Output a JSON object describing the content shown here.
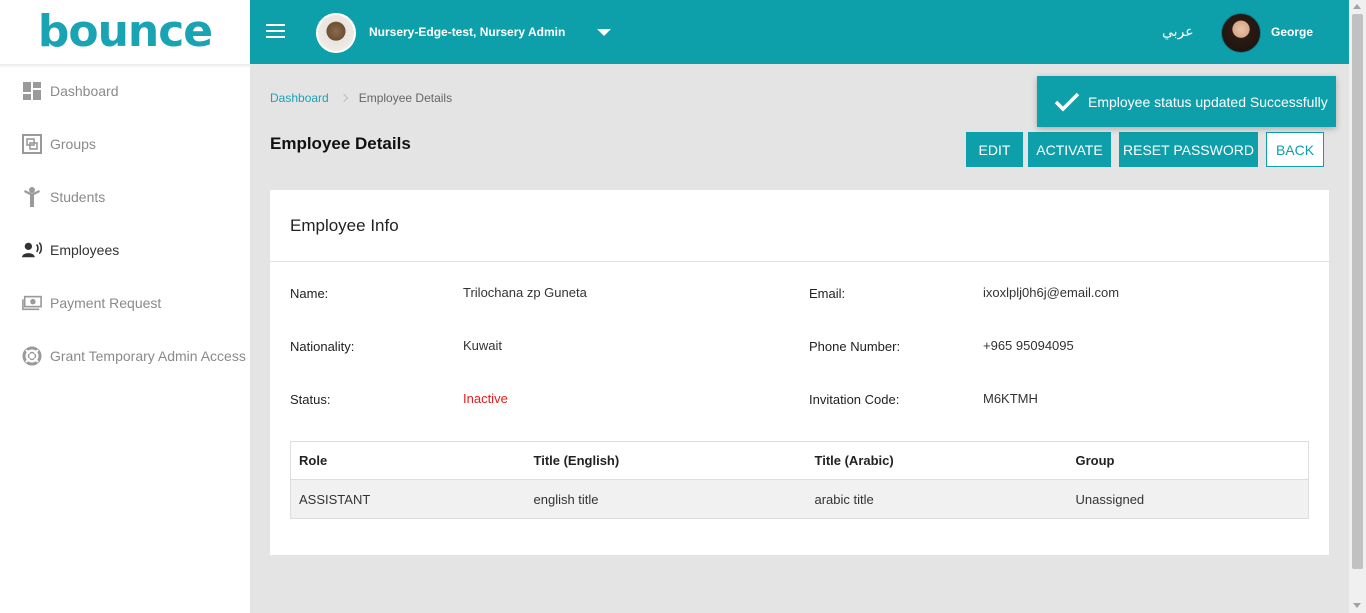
{
  "brand": {
    "logo_text": "bounce",
    "accent": "#0ea0aa",
    "accent_green": "#8cc63f"
  },
  "sidebar": {
    "items": [
      {
        "label": "Dashboard",
        "icon": "dashboard-icon"
      },
      {
        "label": "Groups",
        "icon": "groups-icon"
      },
      {
        "label": "Students",
        "icon": "student-icon"
      },
      {
        "label": "Employees",
        "icon": "employees-icon",
        "active": true
      },
      {
        "label": "Payment Request",
        "icon": "payment-icon"
      },
      {
        "label": "Grant Temporary Admin Access",
        "icon": "lifebuoy-icon"
      }
    ]
  },
  "topbar": {
    "nursery_name": "Nursery-Edge-test, Nursery Admin",
    "language_switch": "عربي",
    "user_name": "George"
  },
  "breadcrumb": {
    "home": "Dashboard",
    "current": "Employee Details"
  },
  "page": {
    "title": "Employee Details"
  },
  "actions": {
    "edit": "EDIT",
    "activate": "ACTIVATE",
    "reset_password": "RESET PASSWORD",
    "back": "BACK"
  },
  "toast": {
    "message": "Employee status updated Successfully"
  },
  "card": {
    "title": "Employee Info",
    "fields": {
      "name_label": "Name:",
      "name_value": "Trilochana zp Guneta",
      "email_label": "Email:",
      "email_value": "ixoxlplj0h6j@email.com",
      "nationality_label": "Nationality:",
      "nationality_value": "Kuwait",
      "phone_label": "Phone Number:",
      "phone_value": "+965 95094095",
      "status_label": "Status:",
      "status_value": "Inactive",
      "invitation_label": "Invitation Code:",
      "invitation_value": "M6KTMH"
    },
    "status_color": "#e02020",
    "table": {
      "headers": [
        "Role",
        "Title (English)",
        "Title (Arabic)",
        "Group"
      ],
      "rows": [
        [
          "ASSISTANT",
          "english title",
          "arabic title",
          "Unassigned"
        ]
      ]
    }
  }
}
